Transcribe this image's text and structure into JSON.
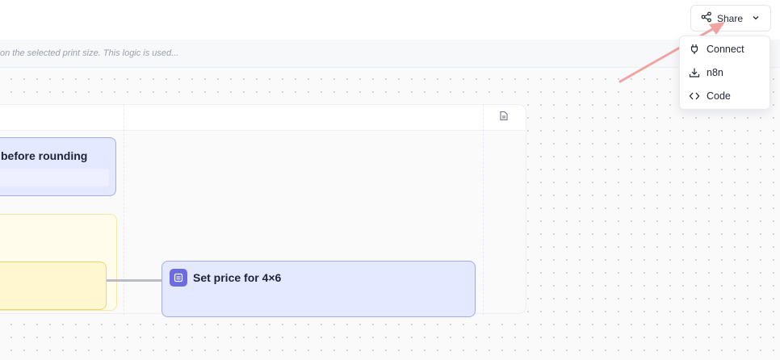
{
  "header": {
    "share_label": "Share"
  },
  "description": {
    "text": "on the selected print size. This logic is used..."
  },
  "share_menu": {
    "items": [
      {
        "label": "Connect",
        "icon": "plug-icon"
      },
      {
        "label": "n8n",
        "icon": "download-icon"
      },
      {
        "label": "Code",
        "icon": "code-icon"
      }
    ]
  },
  "canvas": {
    "nodes": {
      "rounding": {
        "title": "before rounding"
      },
      "price_4x6": {
        "title": "Set price for 4×6",
        "icon": "list-icon"
      }
    }
  },
  "colors": {
    "node_blue": "#e5e9ff",
    "node_blue_border": "#a3acec",
    "node_yellow": "#fffcec",
    "accent_purple": "#6d6be0",
    "arrow": "#f0a3a0"
  }
}
